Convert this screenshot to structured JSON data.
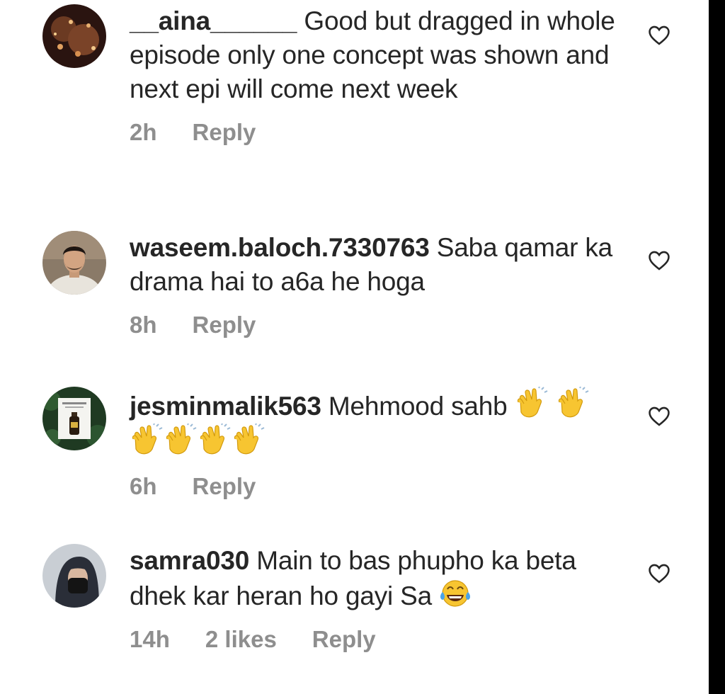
{
  "comments": [
    {
      "username": "__aina______",
      "text": "Good but dragged in whole episode only one concept was shown  and next epi will come next week",
      "time": "2h",
      "likes": "",
      "reply_label": "Reply",
      "avatar_icon": "avatar-photo",
      "emojis": []
    },
    {
      "username": "waseem.baloch.7330763",
      "text": "Saba qamar ka drama hai to a6a he hoga",
      "time": "8h",
      "likes": "",
      "reply_label": "Reply",
      "avatar_icon": "avatar-photo",
      "emojis": []
    },
    {
      "username": "jesminmalik563",
      "text": "Mehmood sahb",
      "time": "6h",
      "likes": "",
      "reply_label": "Reply",
      "avatar_icon": "avatar-photo",
      "emojis": [
        "clapping-hands",
        "clapping-hands",
        "clapping-hands",
        "clapping-hands",
        "clapping-hands",
        "clapping-hands"
      ]
    },
    {
      "username": "samra030",
      "text": "Main to bas phupho ka beta dhek kar heran ho gayi  Sa",
      "time": "14h",
      "likes": "2 likes",
      "reply_label": "Reply",
      "avatar_icon": "avatar-photo",
      "emojis": [
        "tears-of-joy"
      ]
    }
  ],
  "like_icon": "heart-outline-icon",
  "colors": {
    "text": "#262626",
    "meta": "#8e8e8e",
    "background": "#ffffff"
  }
}
